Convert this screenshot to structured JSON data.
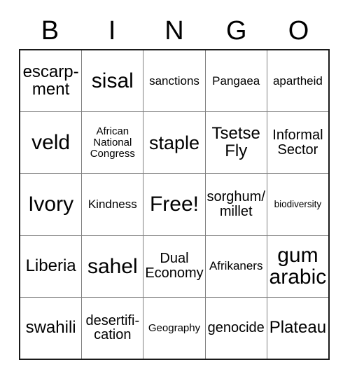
{
  "card": {
    "title": "BINGO",
    "header_letters": [
      "B",
      "I",
      "N",
      "G",
      "O"
    ],
    "free_space_label": "Free!",
    "colors": {
      "background": "#ffffff",
      "text": "#000000",
      "outer_border": "#1a1a1a",
      "inner_border": "#808080"
    },
    "rows": [
      [
        {
          "text": "escarp-\nment",
          "size": "fs-l"
        },
        {
          "text": "sisal",
          "size": "fs-xxl"
        },
        {
          "text": "sanctions",
          "size": "fs-s"
        },
        {
          "text": "Pangaea",
          "size": "fs-s"
        },
        {
          "text": "apartheid",
          "size": "fs-s"
        }
      ],
      [
        {
          "text": "veld",
          "size": "fs-xxl"
        },
        {
          "text": "African\nNational\nCongress",
          "size": "fs-xs"
        },
        {
          "text": "staple",
          "size": "fs-xl"
        },
        {
          "text": "Tsetse\nFly",
          "size": "fs-l"
        },
        {
          "text": "Informal\nSector",
          "size": "fs-m"
        }
      ],
      [
        {
          "text": "Ivory",
          "size": "fs-xxl"
        },
        {
          "text": "Kindness",
          "size": "fs-s"
        },
        {
          "text": "Free!",
          "size": "fs-xxl"
        },
        {
          "text": "sorghum/\nmillet",
          "size": "fs-m"
        },
        {
          "text": "biodiversity",
          "size": "fs-xxs"
        }
      ],
      [
        {
          "text": "Liberia",
          "size": "fs-l"
        },
        {
          "text": "sahel",
          "size": "fs-xxl"
        },
        {
          "text": "Dual\nEconomy",
          "size": "fs-m"
        },
        {
          "text": "Afrikaners",
          "size": "fs-s"
        },
        {
          "text": "gum\narabic",
          "size": "fs-xxl"
        }
      ],
      [
        {
          "text": "swahili",
          "size": "fs-l"
        },
        {
          "text": "desertifi-\ncation",
          "size": "fs-m"
        },
        {
          "text": "Geography",
          "size": "fs-xs"
        },
        {
          "text": "genocide",
          "size": "fs-m"
        },
        {
          "text": "Plateau",
          "size": "fs-l"
        }
      ]
    ]
  }
}
